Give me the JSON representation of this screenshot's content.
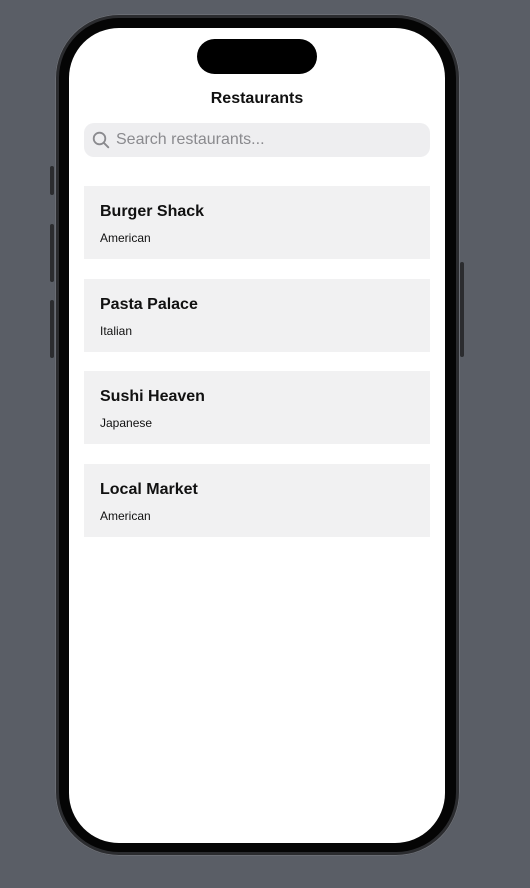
{
  "nav": {
    "title": "Restaurants"
  },
  "search": {
    "placeholder": "Search restaurants...",
    "value": "",
    "icon": "search-icon"
  },
  "restaurants": [
    {
      "name": "Burger Shack",
      "cuisine": "American"
    },
    {
      "name": "Pasta Palace",
      "cuisine": "Italian"
    },
    {
      "name": "Sushi Heaven",
      "cuisine": "Japanese"
    },
    {
      "name": "Local Market",
      "cuisine": "American"
    }
  ],
  "colors": {
    "background": "#5a5e66",
    "screen": "#ffffff",
    "card": "#f1f1f2",
    "search_field": "#eeeef0",
    "placeholder": "#8a8a8e"
  }
}
